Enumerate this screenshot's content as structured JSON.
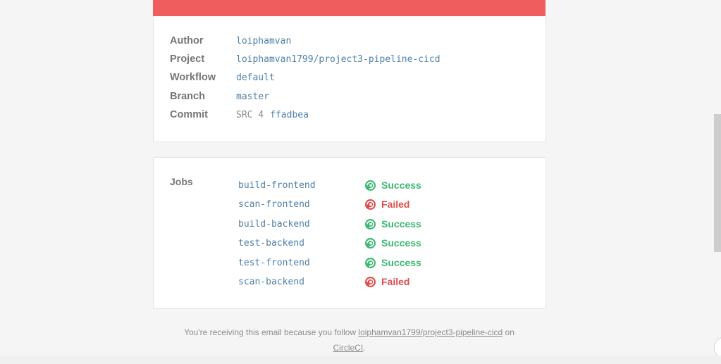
{
  "info": {
    "author_label": "Author",
    "author_value": "loiphamvan",
    "project_label": "Project",
    "project_value": "loiphamvan1799/project3-pipeline-cicd",
    "workflow_label": "Workflow",
    "workflow_value": "default",
    "branch_label": "Branch",
    "branch_value": "master",
    "commit_label": "Commit",
    "commit_prefix": "SRC 4",
    "commit_hash": "ffadbea"
  },
  "jobs": {
    "label": "Jobs",
    "items": [
      {
        "name": "build-frontend",
        "status": "Success"
      },
      {
        "name": "scan-frontend",
        "status": "Failed"
      },
      {
        "name": "build-backend",
        "status": "Success"
      },
      {
        "name": "test-backend",
        "status": "Success"
      },
      {
        "name": "test-frontend",
        "status": "Success"
      },
      {
        "name": "scan-backend",
        "status": "Failed"
      }
    ]
  },
  "footer": {
    "text_before": "You're receiving this email because you follow ",
    "project_link": "loiphamvan1799/project3-pipeline-cicd",
    "text_after": " on",
    "circleci_link": "CircleCI",
    "end": "."
  },
  "colors": {
    "banner": "#f05d5e",
    "success": "#3cb873",
    "failed": "#e04b4b",
    "link": "#4f81a7"
  },
  "icons": {
    "success": "circleci-success-icon",
    "failed": "circleci-failed-icon"
  }
}
